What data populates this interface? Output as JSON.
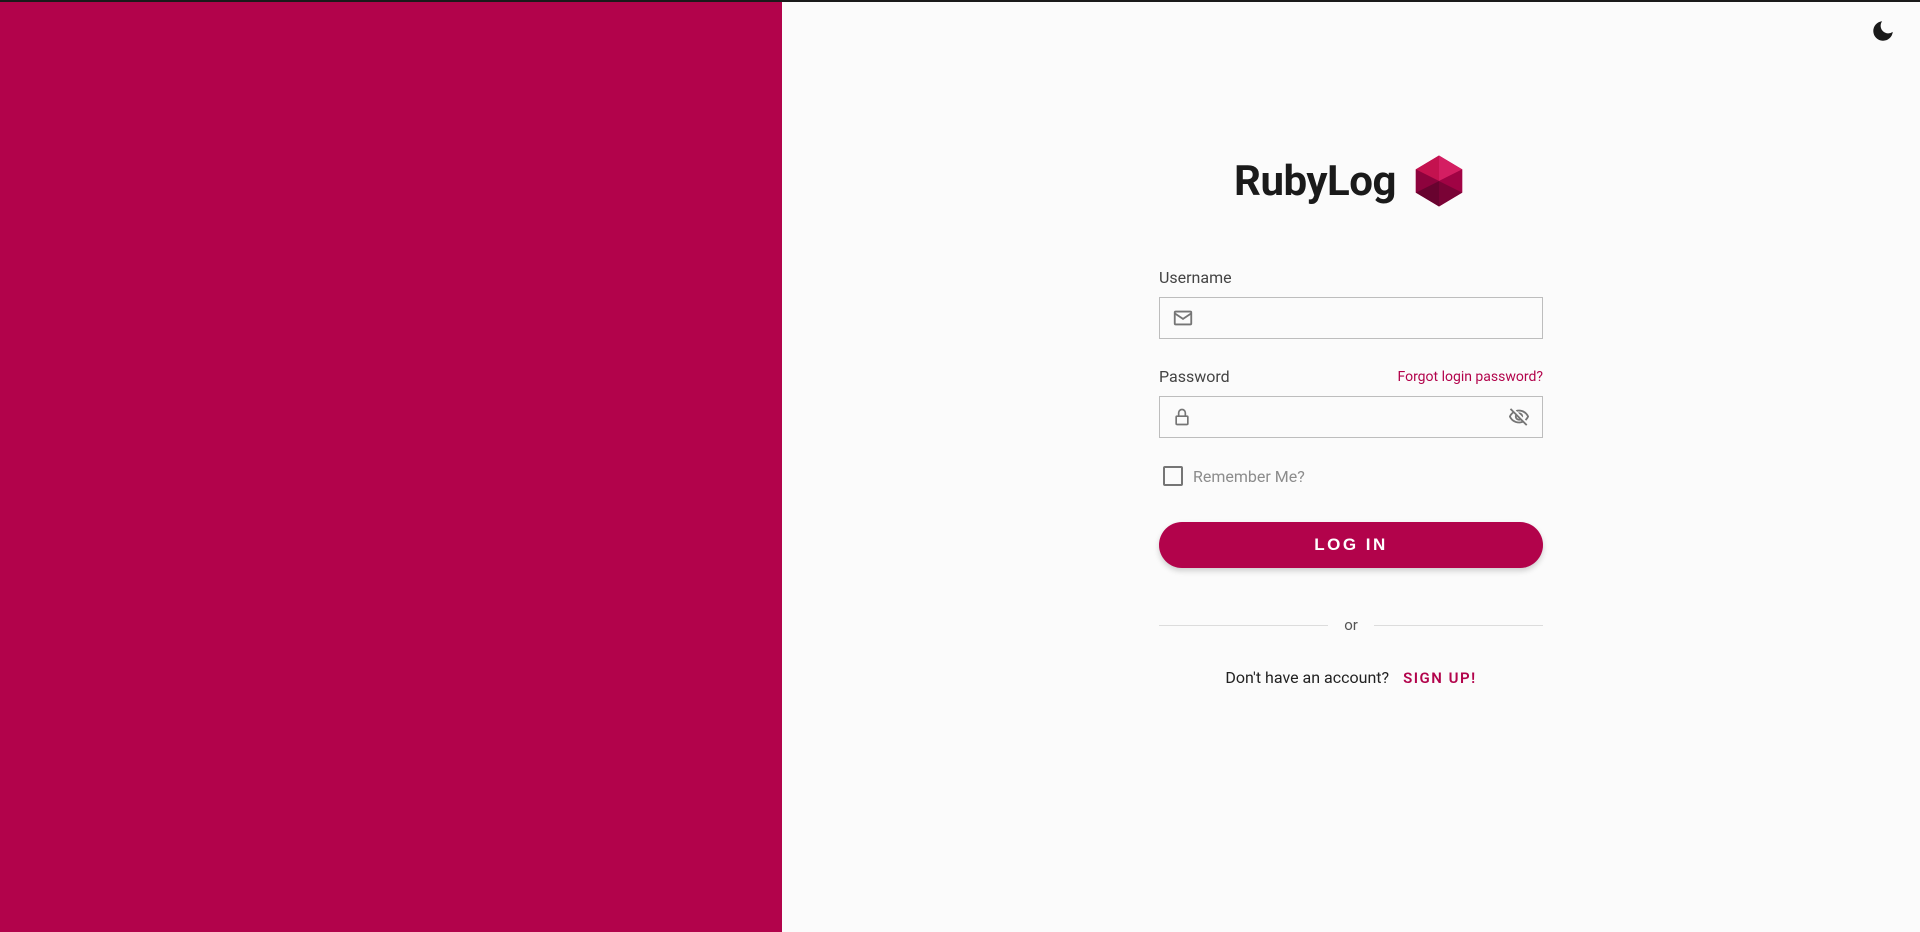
{
  "brand": {
    "name": "RubyLog"
  },
  "form": {
    "username_label": "Username",
    "password_label": "Password",
    "forgot_link": "Forgot login password?",
    "remember_label": "Remember Me?",
    "login_button": "LOG IN"
  },
  "divider": {
    "text": "or"
  },
  "signup": {
    "prompt": "Don't have an account?",
    "link": "SIGN UP!"
  }
}
